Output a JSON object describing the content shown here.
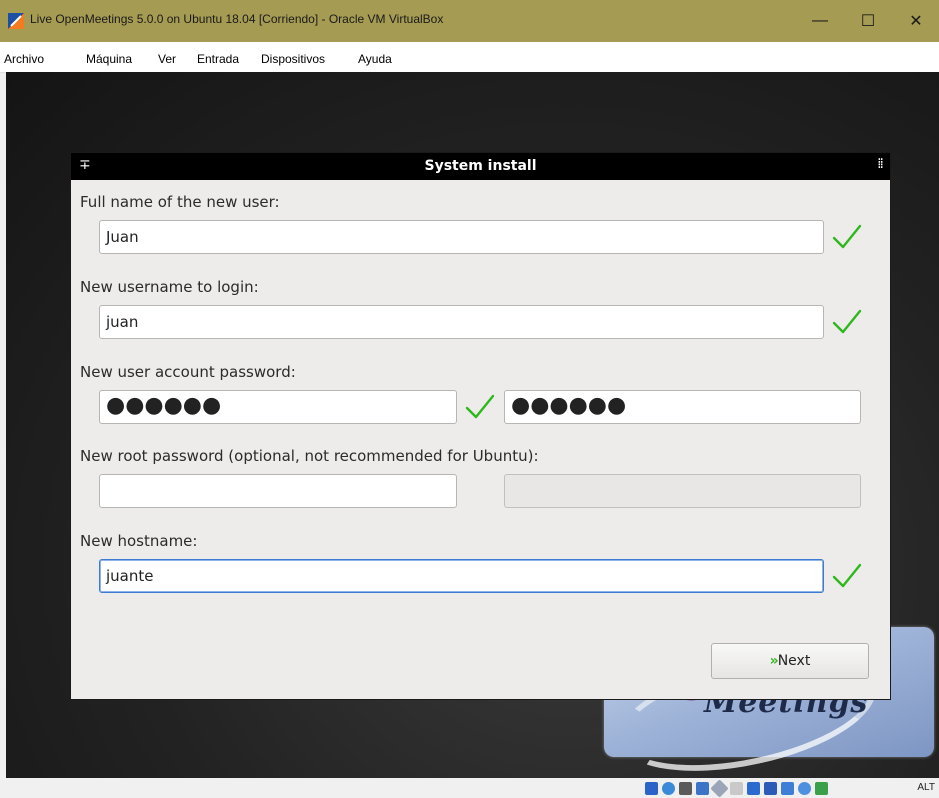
{
  "window": {
    "title": "Live OpenMeetings 5.0.0 on Ubuntu 18.04 [Corriendo] - Oracle VM VirtualBox"
  },
  "window_controls": {
    "minimize": "—",
    "maximize": "☐",
    "close": "✕"
  },
  "menubar": {
    "items": [
      "Archivo",
      "Máquina",
      "Ver",
      "Entrada",
      "Dispositivos",
      "Ayuda"
    ]
  },
  "dialog": {
    "title": "System install",
    "pin_glyph": "∓",
    "menu_glyph": "⁞⁞",
    "full_name_label": "Full name of the new user:",
    "full_name_value": "Juan",
    "username_label": "New username to login:",
    "username_value": "juan",
    "password_label": "New user account password:",
    "password_value": "●●●●●●",
    "password_confirm_value": "●●●●●●",
    "root_password_label": "New root password (optional, not recommended for Ubuntu):",
    "root_password_value": "",
    "root_password_confirm_value": "",
    "hostname_label": "New hostname:",
    "hostname_value": "juante",
    "next_chevron": "»",
    "next_label": "Next"
  },
  "background_logo": {
    "text": "Meetings"
  },
  "statusbar": {
    "host_key": "ALT"
  },
  "colors": {
    "check": "#2fb81d",
    "titlebar": "#a59b52",
    "focus": "#3b7bd4"
  },
  "icons": [
    "virtualbox-icon",
    "check-icon",
    "hdd-icon",
    "optical-icon",
    "audio-icon",
    "network-icon",
    "usb-icon",
    "shared-folder-icon",
    "display-icon",
    "recording-icon",
    "cpu-icon",
    "mouse-integration-icon"
  ]
}
